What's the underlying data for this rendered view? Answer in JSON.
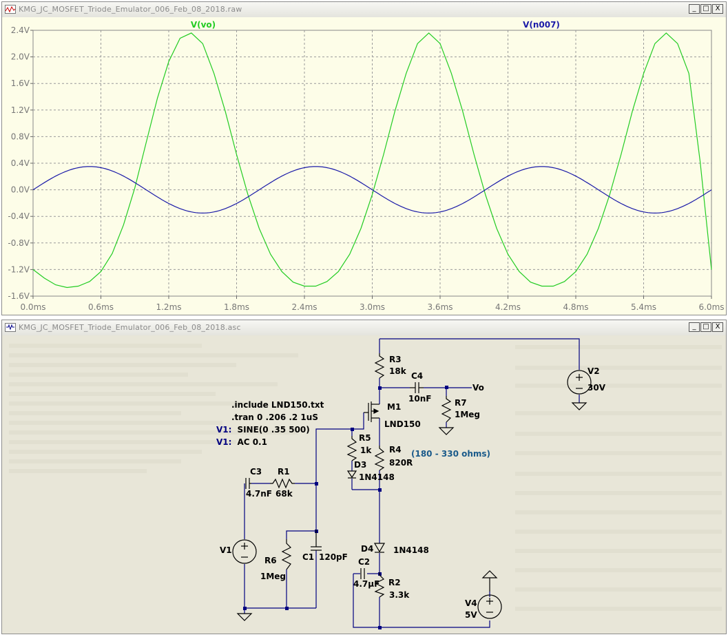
{
  "waveform_window": {
    "title": "KMG_JC_MOSFET_Triode_Emulator_006_Feb_08_2018.raw",
    "buttons": {
      "minimize": "_",
      "restore": "□",
      "close": "X"
    }
  },
  "schematic_window": {
    "title": "KMG_JC_MOSFET_Triode_Emulator_006_Feb_08_2018.asc",
    "buttons": {
      "minimize": "_",
      "restore": "□",
      "close": "X"
    }
  },
  "chart_data": {
    "type": "line",
    "xlabel": "",
    "ylabel": "",
    "x_ticks": [
      "0.0ms",
      "0.6ms",
      "1.2ms",
      "1.8ms",
      "2.4ms",
      "3.0ms",
      "3.6ms",
      "4.2ms",
      "4.8ms",
      "5.4ms",
      "6.0ms"
    ],
    "y_ticks": [
      "2.4V",
      "2.0V",
      "1.6V",
      "1.2V",
      "0.8V",
      "0.4V",
      "0.0V",
      "-0.4V",
      "-0.8V",
      "-1.2V",
      "-1.6V"
    ],
    "xlim_ms": [
      0,
      6.0
    ],
    "ylim_v": [
      -1.6,
      2.4
    ],
    "grid": true,
    "background": "#fdfde8",
    "series": [
      {
        "name": "V(vo)",
        "color": "#22cc22",
        "x_ms": [
          0,
          0.1,
          0.2,
          0.3,
          0.4,
          0.5,
          0.6,
          0.7,
          0.8,
          0.9,
          1.0,
          1.1,
          1.2,
          1.3,
          1.4,
          1.5,
          1.6,
          1.7,
          1.8,
          1.9,
          2.0,
          2.1,
          2.2,
          2.3,
          2.4,
          2.5,
          2.6,
          2.7,
          2.8,
          2.9,
          3.0,
          3.1,
          3.2,
          3.3,
          3.4,
          3.5,
          3.6,
          3.7,
          3.8,
          3.9,
          4.0,
          4.1,
          4.2,
          4.3,
          4.4,
          4.5,
          4.6,
          4.7,
          4.8,
          4.9,
          5.0,
          5.1,
          5.2,
          5.3,
          5.4,
          5.5,
          5.6,
          5.7,
          5.8,
          5.9,
          6.0
        ],
        "y_v": [
          -1.2,
          -1.33,
          -1.43,
          -1.47,
          -1.45,
          -1.38,
          -1.23,
          -0.96,
          -0.53,
          0.03,
          0.71,
          1.38,
          1.93,
          2.28,
          2.36,
          2.2,
          1.75,
          1.18,
          0.53,
          -0.07,
          -0.58,
          -0.97,
          -1.23,
          -1.39,
          -1.45,
          -1.45,
          -1.38,
          -1.23,
          -0.97,
          -0.58,
          -0.07,
          0.53,
          1.18,
          1.75,
          2.2,
          2.36,
          2.2,
          1.75,
          1.18,
          0.53,
          -0.07,
          -0.58,
          -0.97,
          -1.23,
          -1.39,
          -1.45,
          -1.45,
          -1.38,
          -1.23,
          -0.97,
          -0.58,
          -0.07,
          0.53,
          1.18,
          1.75,
          2.2,
          2.36,
          2.2,
          1.75,
          0.42,
          -1.2
        ]
      },
      {
        "name": "V(n007)",
        "color": "#1a1aa8",
        "amplitude_v": 0.35,
        "frequency_hz": 500
      }
    ]
  },
  "schematic": {
    "directives": [
      ".include LND150.txt",
      ".tran 0 .206 .2 1uS"
    ],
    "source_specs": [
      {
        "ref": "V1:",
        "value": "SINE(0 .35 500)"
      },
      {
        "ref": "V1:",
        "value": "AC 0.1"
      }
    ],
    "note": "(180 - 330 ohms)",
    "net_label": "Vo",
    "components": {
      "R3": {
        "ref": "R3",
        "value": "18k"
      },
      "C4": {
        "ref": "C4",
        "value": "10nF"
      },
      "R7": {
        "ref": "R7",
        "value": "1Meg"
      },
      "V2": {
        "ref": "V2",
        "value": "30V"
      },
      "M1": {
        "ref": "M1",
        "value": "LND150"
      },
      "R5": {
        "ref": "R5",
        "value": "1k"
      },
      "R4": {
        "ref": "R4",
        "value": "820R"
      },
      "D3": {
        "ref": "D3",
        "value": "1N4148"
      },
      "C3": {
        "ref": "C3",
        "value": "4.7nF"
      },
      "R1": {
        "ref": "R1",
        "value": "68k"
      },
      "V1": {
        "ref": "V1",
        "value": ""
      },
      "R6": {
        "ref": "R6",
        "value": "1Meg"
      },
      "C1": {
        "ref": "C1",
        "value": "120pF"
      },
      "D4": {
        "ref": "D4",
        "value": "1N4148"
      },
      "C2": {
        "ref": "C2",
        "value": "4.7µF"
      },
      "R2": {
        "ref": "R2",
        "value": "3.3k"
      },
      "V4": {
        "ref": "V4",
        "value": "5V"
      }
    },
    "colors": {
      "wire": "#000080",
      "component": "#000000",
      "directive_ref": "#000080",
      "note": "#1a5a8a"
    }
  }
}
